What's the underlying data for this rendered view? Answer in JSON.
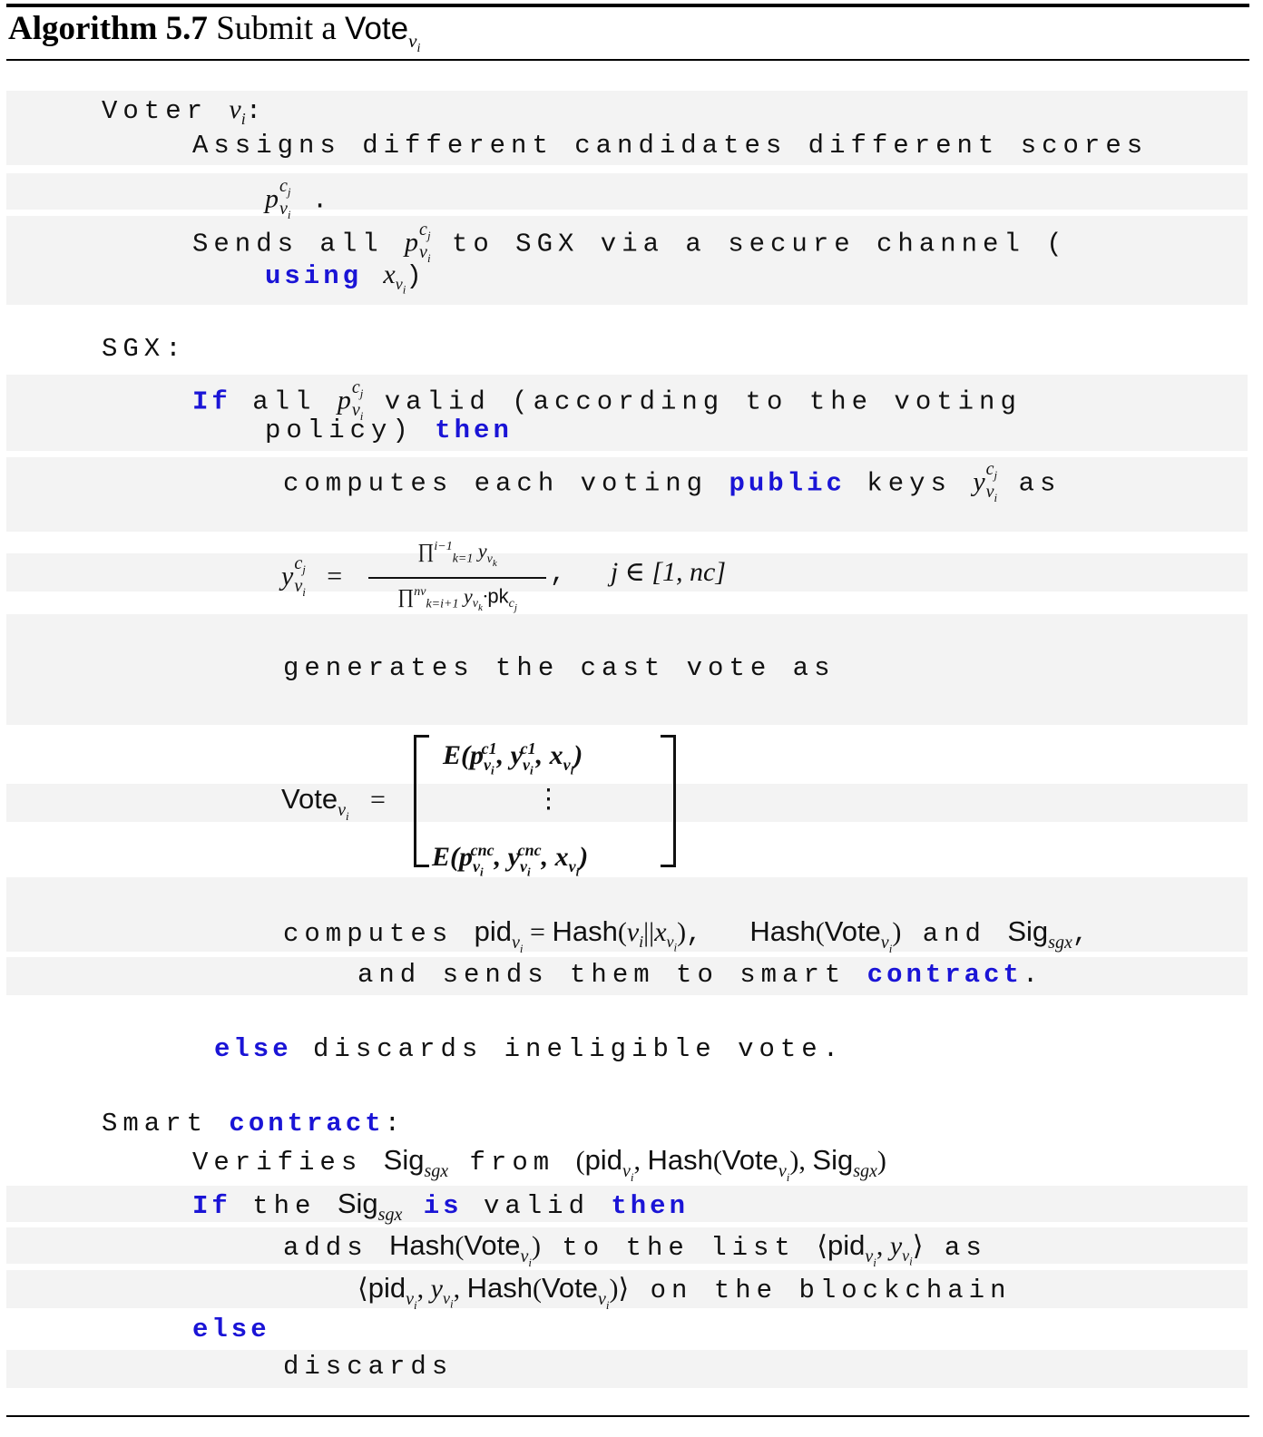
{
  "header": {
    "label": "Algorithm 5.7",
    "title": "Submit a",
    "vote_symbol": "Vote",
    "vote_sub": "vi"
  },
  "voter": {
    "label": "Voter",
    "var": "vi",
    "assign_text": "Assigns different candidates different scores",
    "send_text_a": "Sends all",
    "send_text_b": "to SGX via a secure channel (",
    "using_kw": "using",
    "using_var": "xvi",
    "close_paren": ")"
  },
  "sgx": {
    "label": "SGX",
    "if_kw": "If",
    "if_text_a": "all",
    "if_text_b": "valid (according to the voting",
    "if_text_c": "policy)",
    "then_kw": "then",
    "compute_text": "computes each voting",
    "public_kw": "public",
    "compute_text_b": "keys",
    "compute_text_c": "as",
    "formula_range": "j ∈ [1, nc]",
    "generate_text": "generates the cast vote as",
    "vote_lhs": "Vote",
    "matrix_top": "E(pvic1, yvic1, xvi)",
    "matrix_dots": "⋮",
    "matrix_bottom": "E(pvicnc, yvicnc, xvi)",
    "compute2_text": "computes",
    "pid_expr": "pidvi = Hash(vi||xvi),",
    "hash_vote": "Hash(Votevi)",
    "and_text": "and",
    "sig_sgx": "Sigsgx",
    "send2_text": "and sends them to smart",
    "contract_kw": "contract",
    "period": ".",
    "else_kw": "else",
    "else_text": "discards ineligible vote."
  },
  "contract": {
    "label_a": "Smart",
    "label_kw": "contract",
    "verify_text": "Verifies",
    "verify_from": "from",
    "verify_tuple": "(pidvi, Hash(Votevi), Sigsgx)",
    "if_kw": "If",
    "the_text": "the",
    "is_kw": "is",
    "valid_text": "valid",
    "then_kw": "then",
    "adds_text": "adds",
    "adds_text_b": "to the list",
    "list_expr": "⟨pidvi, yvi⟩",
    "as_text": "as",
    "tuple_expr": "⟨pidvi, yvi, Hash(Votevi)⟩",
    "blockchain_text": "on the blockchain",
    "else_kw": "else",
    "discards_text": "discards"
  },
  "colors": {
    "keyword": "#1a14d6",
    "band": "#f3f3f3"
  }
}
